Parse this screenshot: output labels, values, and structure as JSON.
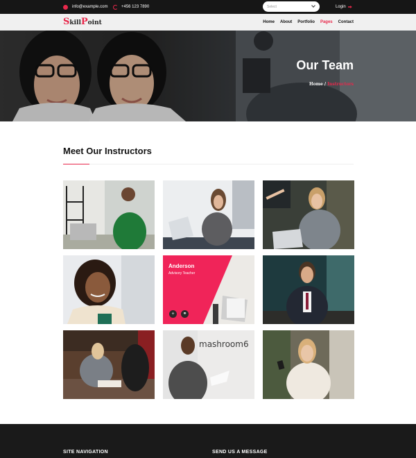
{
  "topbar": {
    "email": "info@example.com",
    "phone": "+456 123 7890",
    "select_placeholder": "Select",
    "login_label": "Login"
  },
  "navbar": {
    "logo": {
      "part1": "S",
      "part2": "kill",
      "part3": "P",
      "part4": "oint"
    },
    "menu": [
      {
        "label": "Home",
        "active": false
      },
      {
        "label": "About",
        "active": false
      },
      {
        "label": "Portfolio",
        "active": false
      },
      {
        "label": "Pages",
        "active": true
      },
      {
        "label": "Contact",
        "active": false
      }
    ]
  },
  "hero": {
    "title": "Our Team",
    "breadcrumb": {
      "home": "Home",
      "separator": "/",
      "current": "Instructors"
    }
  },
  "section": {
    "title": "Meet Our Instructors"
  },
  "featured": {
    "name": "Anderson",
    "role": "Advisory Teacher",
    "icons": [
      "plus-icon",
      "link-icon"
    ]
  },
  "footer": {
    "col1_title": "SITE NAVIGATION",
    "col2_title": "SEND US A MESSAGE"
  },
  "colors": {
    "accent": "#e8284b",
    "topbar": "#161616",
    "navbar": "#f0f0f0",
    "footer": "#1a1a1a",
    "featured_overlay": "#f02459"
  }
}
